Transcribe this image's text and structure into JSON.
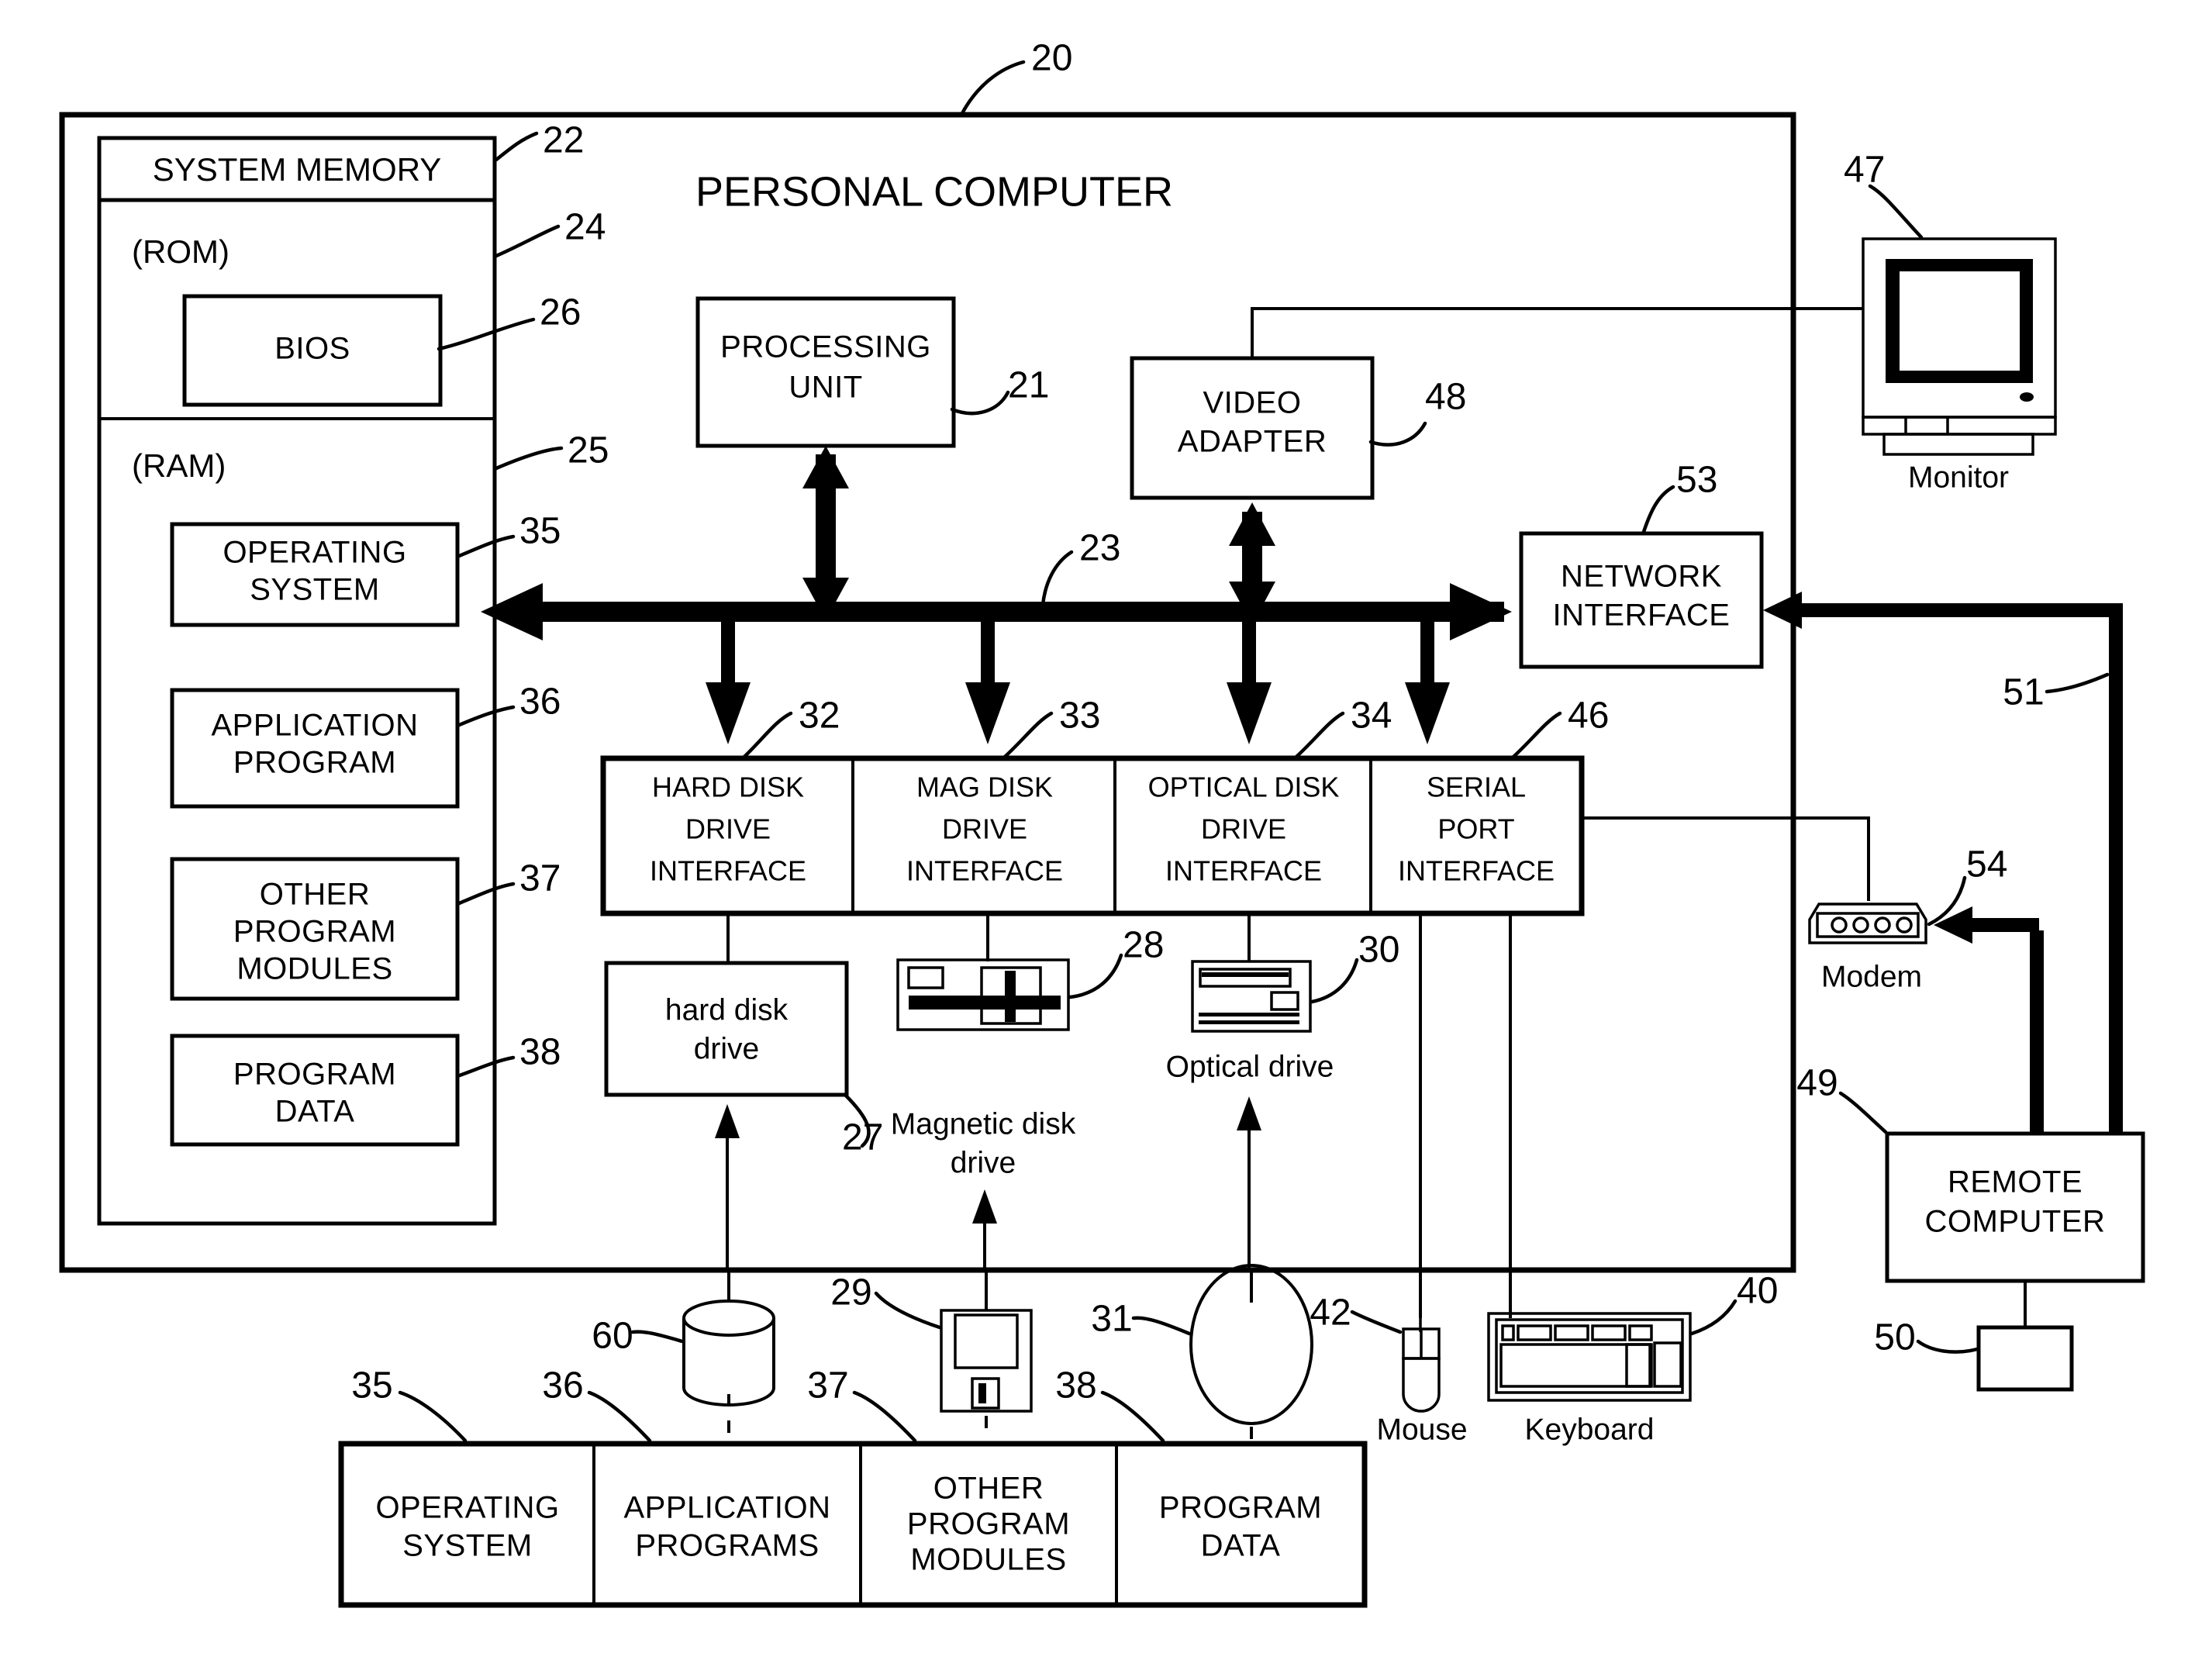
{
  "figure": {
    "title": "PERSONAL COMPUTER",
    "outer_ref": "20"
  },
  "system_memory": {
    "header": "SYSTEM MEMORY",
    "header_ref": "22",
    "rom_label": "(ROM)",
    "rom_ref": "24",
    "bios_label": "BIOS",
    "bios_ref": "26",
    "ram_label": "(RAM)",
    "ram_ref": "25",
    "ram_items": [
      {
        "label_line1": "OPERATING",
        "label_line2": "SYSTEM",
        "label_line3": "",
        "ref": "35"
      },
      {
        "label_line1": "APPLICATION",
        "label_line2": "PROGRAM",
        "label_line3": "",
        "ref": "36"
      },
      {
        "label_line1": "OTHER",
        "label_line2": "PROGRAM",
        "label_line3": "MODULES",
        "ref": "37"
      },
      {
        "label_line1": "PROGRAM",
        "label_line2": "DATA",
        "label_line3": "",
        "ref": "38"
      }
    ]
  },
  "processing_unit": {
    "line1": "PROCESSING",
    "line2": "UNIT",
    "ref": "21"
  },
  "video_adapter": {
    "line1": "VIDEO",
    "line2": "ADAPTER",
    "ref": "48"
  },
  "bus": {
    "ref": "23"
  },
  "network_interface": {
    "line1": "NETWORK",
    "line2": "INTERFACE",
    "ref": "53"
  },
  "interfaces": [
    {
      "line1": "HARD DISK",
      "line2": "DRIVE",
      "line3": "INTERFACE",
      "ref": "32"
    },
    {
      "line1": "MAG DISK",
      "line2": "DRIVE",
      "line3": "INTERFACE",
      "ref": "33"
    },
    {
      "line1": "OPTICAL DISK",
      "line2": "DRIVE",
      "line3": "INTERFACE",
      "ref": "34"
    },
    {
      "line1": "SERIAL",
      "line2": "PORT",
      "line3": "INTERFACE",
      "ref": "46"
    }
  ],
  "drives": {
    "hard_disk": {
      "line1": "hard disk",
      "line2": "drive",
      "ref": "27"
    },
    "magnetic_disk": {
      "line1": "Magnetic disk",
      "line2": "drive",
      "ref": "28"
    },
    "optical": {
      "line1": "Optical drive",
      "ref": "30"
    }
  },
  "media": {
    "hard_disk_platter_ref": "60",
    "floppy_ref": "29",
    "optical_disc_ref": "31"
  },
  "storage_programs": [
    {
      "line1": "OPERATING",
      "line2": "SYSTEM",
      "line3": "",
      "ref": "35"
    },
    {
      "line1": "APPLICATION",
      "line2": "PROGRAMS",
      "line3": "",
      "ref": "36"
    },
    {
      "line1": "OTHER",
      "line2": "PROGRAM",
      "line3": "MODULES",
      "ref": "37"
    },
    {
      "line1": "PROGRAM",
      "line2": "DATA",
      "line3": "",
      "ref": "38"
    }
  ],
  "peripherals": {
    "monitor": {
      "label": "Monitor",
      "ref": "47"
    },
    "mouse": {
      "label": "Mouse",
      "ref": "42"
    },
    "keyboard": {
      "label": "Keyboard",
      "ref": "40"
    },
    "modem": {
      "label": "Modem",
      "ref": "54"
    }
  },
  "remote": {
    "line1": "REMOTE",
    "line2": "COMPUTER",
    "ref": "49",
    "memory_ref": "50",
    "network_link_ref": "51"
  },
  "colors": {
    "ink": "#000000",
    "paper": "#ffffff"
  }
}
